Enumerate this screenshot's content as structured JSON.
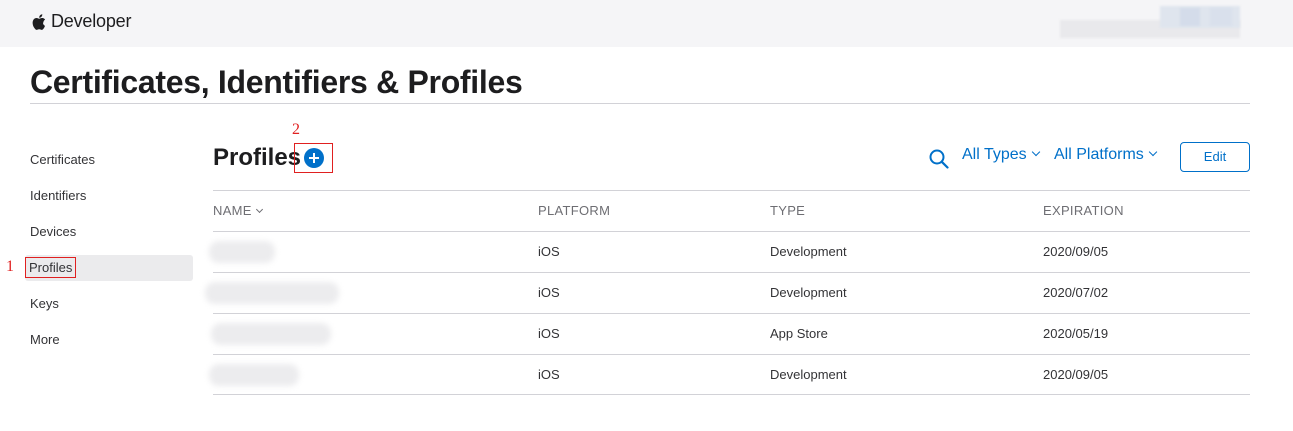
{
  "topbar": {
    "brand": "Developer"
  },
  "page": {
    "title": "Certificates, Identifiers & Profiles"
  },
  "sidebar": {
    "items": [
      {
        "label": "Certificates"
      },
      {
        "label": "Identifiers"
      },
      {
        "label": "Devices"
      },
      {
        "label": "Profiles",
        "active": true
      },
      {
        "label": "Keys"
      },
      {
        "label": "More"
      }
    ]
  },
  "annotations": {
    "step1": "1",
    "step2": "2"
  },
  "section": {
    "title": "Profiles",
    "filter_types": "All Types",
    "filter_platforms": "All Platforms",
    "edit_label": "Edit"
  },
  "table": {
    "headers": {
      "name": "NAME",
      "platform": "PLATFORM",
      "type": "TYPE",
      "expiration": "EXPIRATION"
    },
    "rows": [
      {
        "platform": "iOS",
        "type": "Development",
        "expiration": "2020/09/05"
      },
      {
        "platform": "iOS",
        "type": "Development",
        "expiration": "2020/07/02"
      },
      {
        "platform": "iOS",
        "type": "App Store",
        "expiration": "2020/05/19"
      },
      {
        "platform": "iOS",
        "type": "Development",
        "expiration": "2020/09/05"
      }
    ]
  },
  "colors": {
    "accent": "#0070c9",
    "annotation": "#e02020",
    "topbar_bg": "#f5f5f7"
  },
  "icons": {
    "brand": "apple-logo-icon",
    "search": "search-icon",
    "add": "plus-circle-icon"
  }
}
